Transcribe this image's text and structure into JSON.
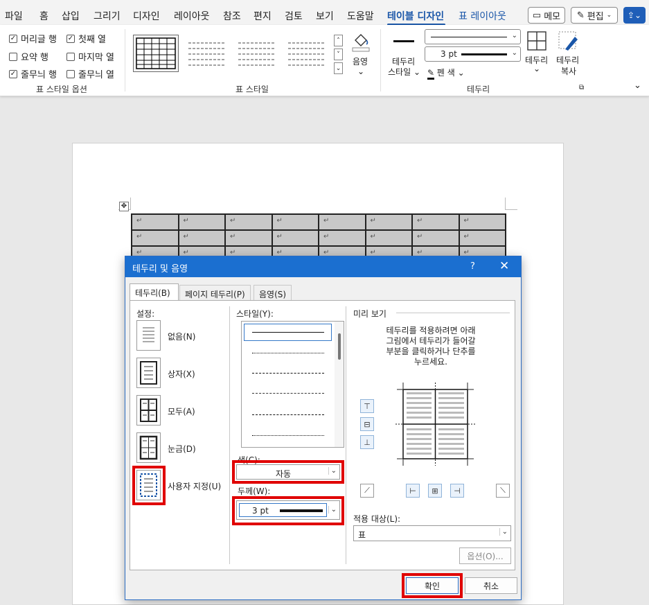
{
  "menubar": {
    "tabs": [
      "파일",
      "홈",
      "삽입",
      "그리기",
      "디자인",
      "레이아웃",
      "참조",
      "편지",
      "검토",
      "보기",
      "도움말",
      "테이블 디자인",
      "표 레이아웃"
    ],
    "active_tab": "테이블 디자인",
    "memo_button": "메모",
    "edit_button": "편집",
    "accent_color": "#1a56a8"
  },
  "ribbon": {
    "style_options": {
      "header_row": "머리글 행",
      "first_column": "첫째 열",
      "total_row": "요약 행",
      "last_column": "마지막 열",
      "banded_rows": "줄무늬 행",
      "banded_columns": "줄무늬 열",
      "group_label": "표 스타일 옵션"
    },
    "table_styles_label": "표 스타일",
    "shading_label": "음영",
    "border_styles": [
      "테두리",
      "스타일"
    ],
    "pen_weight": "3 pt",
    "pen_color": "펜 색",
    "borders_button": "테두리",
    "border_painter": [
      "테두리",
      "복사"
    ],
    "borders_group_label": "테두리"
  },
  "document": {
    "cell_mark": "↵"
  },
  "dialog": {
    "title": "테두리 및 음영",
    "help": "?",
    "tabs": [
      "테두리(B)",
      "페이지 테두리(P)",
      "음영(S)"
    ],
    "active_tab": "테두리(B)",
    "settings_label": "설정:",
    "settings": [
      "없음(N)",
      "상자(X)",
      "모두(A)",
      "눈금(D)",
      "사용자 지정(U)"
    ],
    "style_label": "스타일(Y):",
    "color_label": "색(C):",
    "color_value": "자동",
    "width_label": "두께(W):",
    "width_value": "3 pt",
    "preview_label": "미리 보기",
    "preview_hint": [
      "테두리를 적용하려면 아래",
      "그림에서 테두리가 들어갈",
      "부분을 클릭하거나 단추를",
      "누르세요."
    ],
    "apply_to_label": "적용 대상(L):",
    "apply_to_value": "표",
    "options_button": "옵션(O)...",
    "ok_button": "확인",
    "cancel_button": "취소",
    "highlight_color": "#e00000",
    "title_color": "#1b6fd0"
  }
}
